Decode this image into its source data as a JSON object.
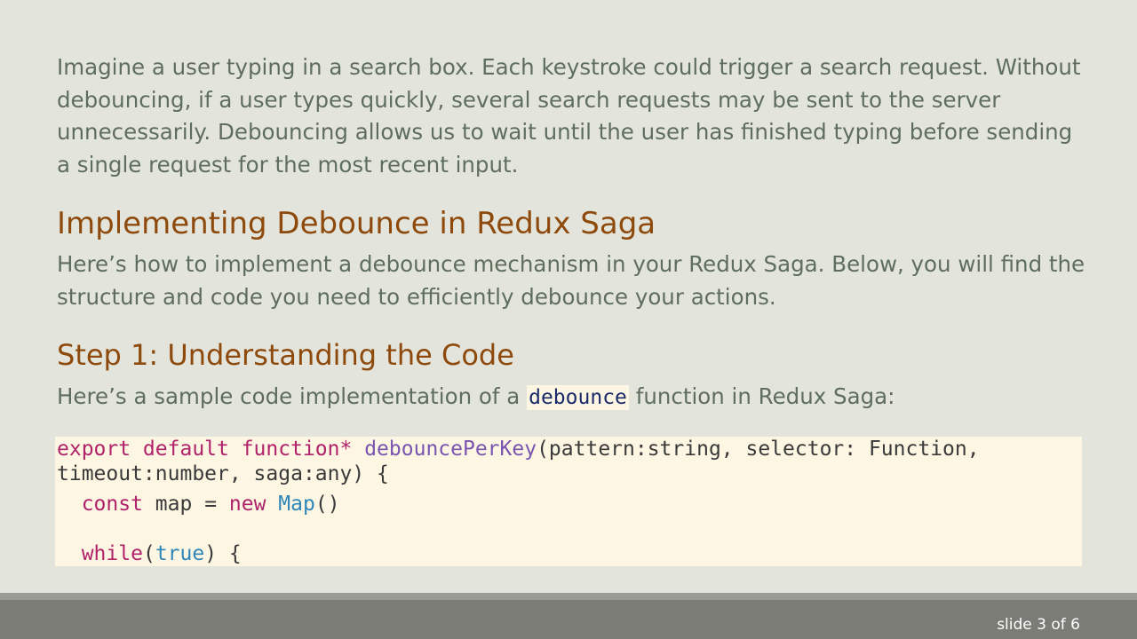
{
  "intro_paragraph": "Imagine a user typing in a search box. Each keystroke could trigger a search request. Without debouncing, if a user types quickly, several search requests may be sent to the server unnecessarily. Debouncing allows us to wait until the user has finished typing before sending a single request for the most recent input.",
  "section_heading": "Implementing Debounce in Redux Saga",
  "section_paragraph": "Here’s how to implement a debounce mechanism in your Redux Saga. Below, you will find the structure and code you need to efficiently debounce your actions.",
  "step_heading": "Step 1: Understanding the Code",
  "step_paragraph": {
    "before": "Here’s a sample code implementation of a",
    "code": "debounce",
    "after": "function in Redux Saga:"
  },
  "code": {
    "line1": {
      "kw1": "export default function*",
      "fn": "debouncePerKey",
      "rest": "(pattern:string, selector: Function,"
    },
    "line2": "timeout:number, saga:any) {",
    "line3": {
      "indent": "  ",
      "kw": "const",
      "mid": " map = ",
      "kw2": "new",
      "cls": "Map",
      "end": "()"
    },
    "line4": {
      "indent": "  ",
      "kw": "while",
      "open": "(",
      "val": "true",
      "end": ") {"
    }
  },
  "footer": {
    "slide_counter": "slide 3 of 6"
  }
}
